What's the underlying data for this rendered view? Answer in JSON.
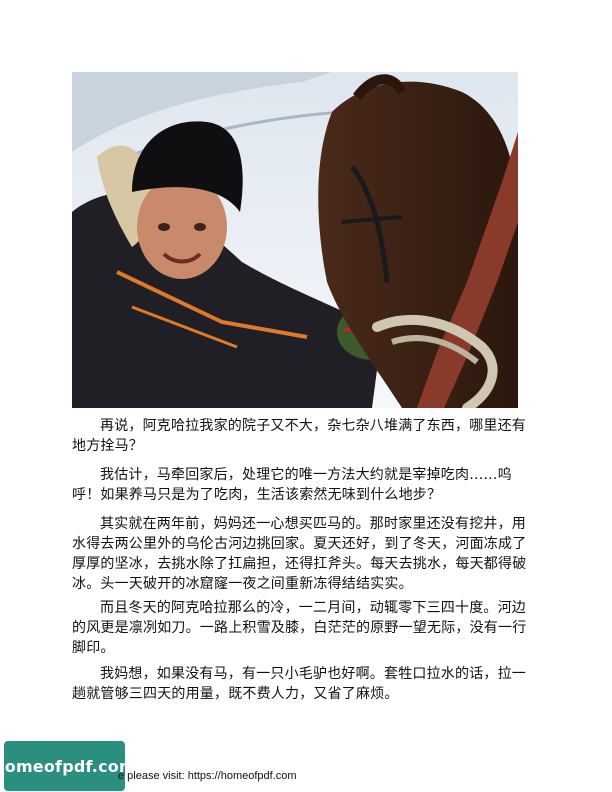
{
  "photo": {
    "icon": "photo-child-with-horse"
  },
  "paragraphs": [
    "再说，阿克哈拉我家的院子又不大，杂七杂八堆满了东西，哪里还有地方拴马？",
    "我估计，马牵回家后，处理它的唯一方法大约就是宰掉吃肉……呜呼！如果养马只是为了吃肉，生活该索然无味到什么地步？",
    "其实就在两年前，妈妈还一心想买匹马的。那时家里还没有挖井，用水得去两公里外的乌伦古河边挑回家。夏天还好，到了冬天，河面冻成了厚厚的坚冰，去挑水除了扛扁担，还得扛斧头。每天去挑水，每天都得破冰。头一天破开的冰窟窿一夜之间重新冻得结结实实。",
    "而且冬天的阿克哈拉那么的冷，一二月间，动辄零下三四十度。河边的风更是凛冽如刀。一路上积雪及膝，白茫茫的原野一望无际，没有一行脚印。",
    "我妈想，如果没有马，有一只小毛驴也好啊。套牲口拉水的话，拉一趟就管够三四天的用量，既不费人力，又省了麻烦。"
  ],
  "footer": {
    "badge_text": "homeofpdf.com",
    "visit_text": "e please visit: https://homeofpdf.com",
    "badge_color": "#2a8f7f"
  }
}
